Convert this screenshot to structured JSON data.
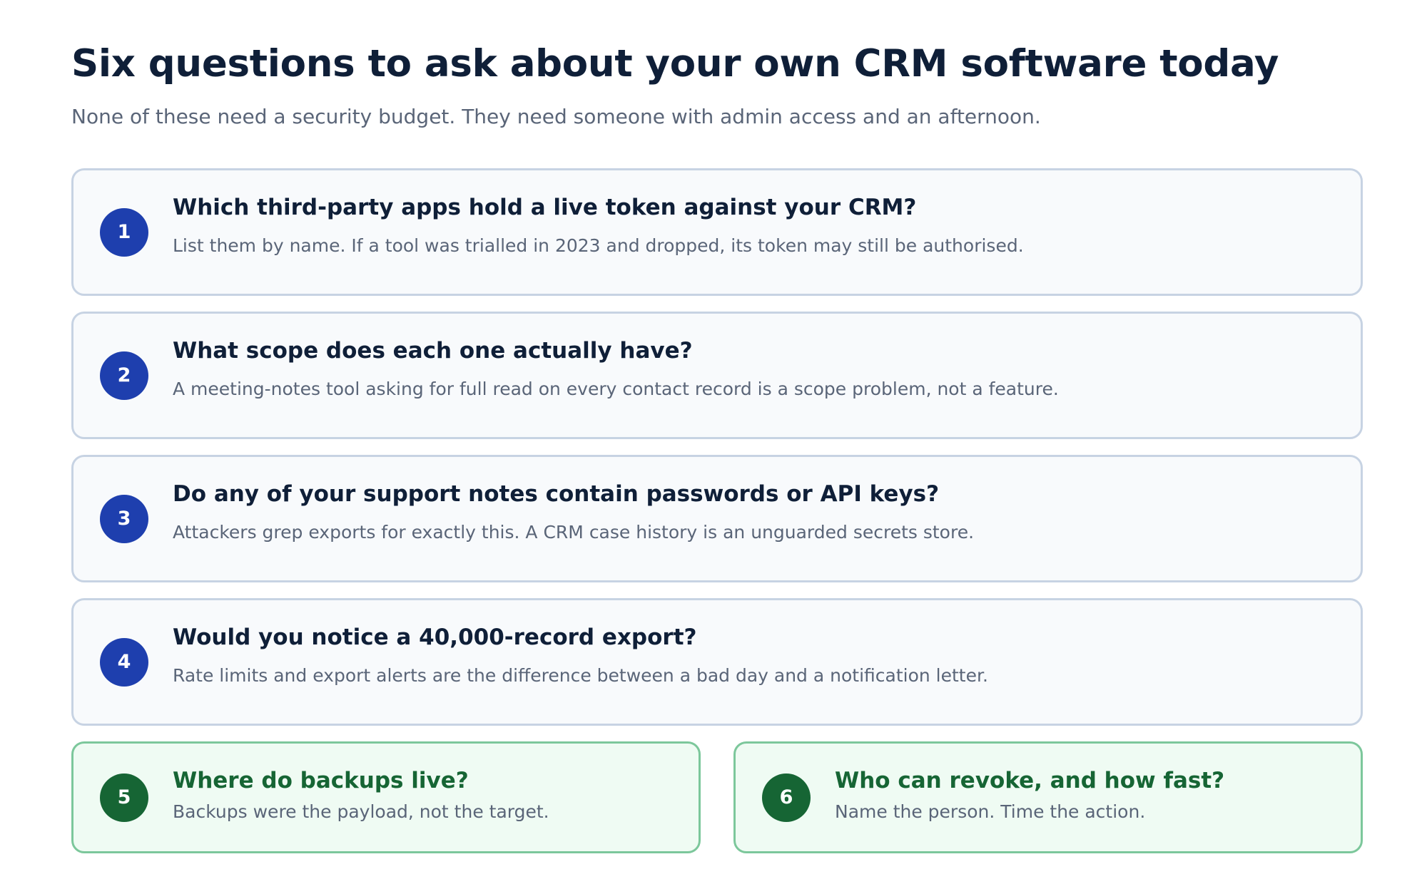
{
  "header": {
    "title": "Six questions to ask about your own CRM software today",
    "subtitle": "None of these need a security budget. They need someone with admin access and an afternoon."
  },
  "questions": [
    {
      "number": "1",
      "question": "Which third-party apps hold a live token against your CRM?",
      "detail": "List them by name. If a tool was trialled in 2023 and dropped, its token may still be authorised."
    },
    {
      "number": "2",
      "question": "What scope does each one actually have?",
      "detail": "A meeting-notes tool asking for full read on every contact record is a scope problem, not a feature."
    },
    {
      "number": "3",
      "question": "Do any of your support notes contain passwords or API keys?",
      "detail": "Attackers grep exports for exactly this. A CRM case history is an unguarded secrets store."
    },
    {
      "number": "4",
      "question": "Would you notice a 40,000-record export?",
      "detail": "Rate limits and export alerts are the difference between a bad day and a notification letter."
    },
    {
      "number": "5",
      "question": "Where do backups live?",
      "detail": "Backups were the payload, not the target."
    },
    {
      "number": "6",
      "question": "Who can revoke, and how fast?",
      "detail": "Name the person. Time the action."
    }
  ],
  "colors": {
    "title": "#0f1f38",
    "muted_text": "#5a6578",
    "blue_badge": "#1e3fae",
    "blue_card_border": "#c7d3e3",
    "blue_card_bg": "#f8fafc",
    "green_badge": "#166534",
    "green_card_border": "#7cc79b",
    "green_card_bg": "#effbf3"
  }
}
